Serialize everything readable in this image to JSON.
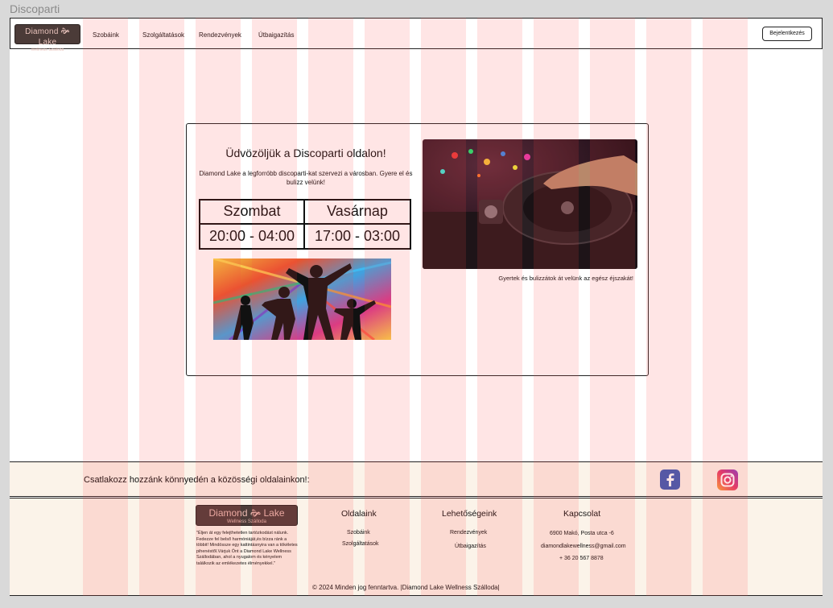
{
  "window": {
    "title": "Discoparti"
  },
  "nav": {
    "logo": {
      "line1": "Diamond 🙞 Lake",
      "line2": "Wellness Szálloda"
    },
    "links": [
      "Szobáink",
      "Szolgáltatások",
      "Rendezvények",
      "Útbaigazítás"
    ],
    "login_label": "Bejelentkezés"
  },
  "main": {
    "title": "Üdvözöljük a Discoparti oldalon!",
    "intro": "Diamond Lake a legforróbb discoparti-kat szervezi a városban. Gyere el és bulizz velünk!",
    "schedule": {
      "days": [
        "Szombat",
        "Vasárnap"
      ],
      "times": [
        "20:00 - 04:00",
        "17:00 - 03:00"
      ]
    },
    "dj_caption": "Gyertek és bulizzátok át velünk az egész éjszakát!"
  },
  "social": {
    "text": "Csatlakozz hozzánk könnyedén a közösségi oldalainkon!:",
    "icons": [
      "facebook-icon",
      "instagram-icon"
    ]
  },
  "footer": {
    "logo": {
      "line1": "Diamond 🙞 Lake",
      "line2": "Wellness Szálloda"
    },
    "quote": "\"Éljen át egy felejthetetlen tartózkodást nálunk. Fedezze fel belső harmóniáját,és bízza ránk a többit! Mindössze egy kattintásnyira van a tökéletes pihenéstől.Várjuk Önt a Diamond Lake Wellness Szállodában, ahol a nyugalom és kényelem találkozik az emlékezetes élményekkel.\"",
    "columns": {
      "pages": {
        "heading": "Oldalaink",
        "links": [
          "Szobáink",
          "Szolgáltatások"
        ]
      },
      "options": {
        "heading": "Lehetőségeink",
        "links": [
          "Rendezvények",
          "Útbaigazítás"
        ]
      },
      "contact": {
        "heading": "Kapcsolat",
        "lines": [
          "6900 Makó, Posta  utca -6",
          "diamondlakewellness@gmail.com",
          "+ 36 20 567 8878"
        ]
      }
    },
    "copyright": "© 2024 Minden jog fenntartva. |Diamond Lake Wellness Szálloda|"
  },
  "colors": {
    "logo_bg": "#4b3b38",
    "footer_bg": "#fbf3e9",
    "grid_overlay": "#ff4646"
  }
}
